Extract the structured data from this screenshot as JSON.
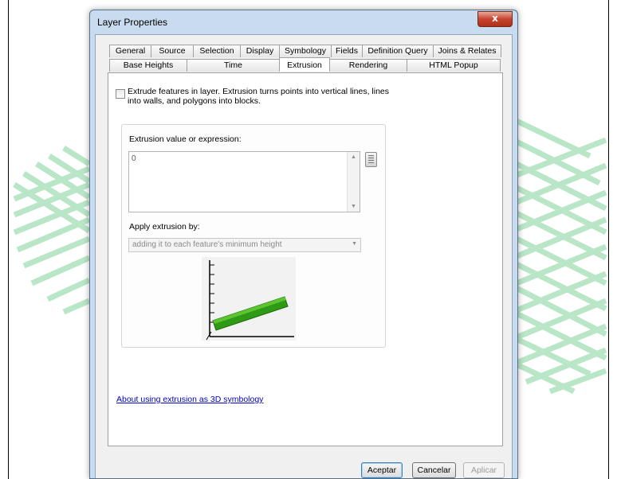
{
  "window": {
    "title": "Layer Properties",
    "close_label": "x"
  },
  "tabs": {
    "row1": [
      "General",
      "Source",
      "Selection",
      "Display",
      "Symbology",
      "Fields",
      "Definition Query",
      "Joins & Relates"
    ],
    "row2": [
      "Base Heights",
      "Time",
      "Extrusion",
      "Rendering",
      "HTML Popup"
    ],
    "active": "Extrusion"
  },
  "extrusion": {
    "checkbox_label": "Extrude features in layer.  Extrusion turns points into vertical lines, lines into walls, and polygons into blocks.",
    "checked": false,
    "value_label": "Extrusion value or expression:",
    "value": "0",
    "apply_label": "Apply extrusion by:",
    "apply_value": "adding it to each feature's minimum height"
  },
  "link_text": "About using extrusion as 3D symbology",
  "buttons": {
    "ok": "Aceptar",
    "cancel": "Cancelar",
    "apply": "Aplicar"
  },
  "colors": {
    "background_pattern": "#b8e6c6",
    "preview_bar": "#2f9a16"
  }
}
